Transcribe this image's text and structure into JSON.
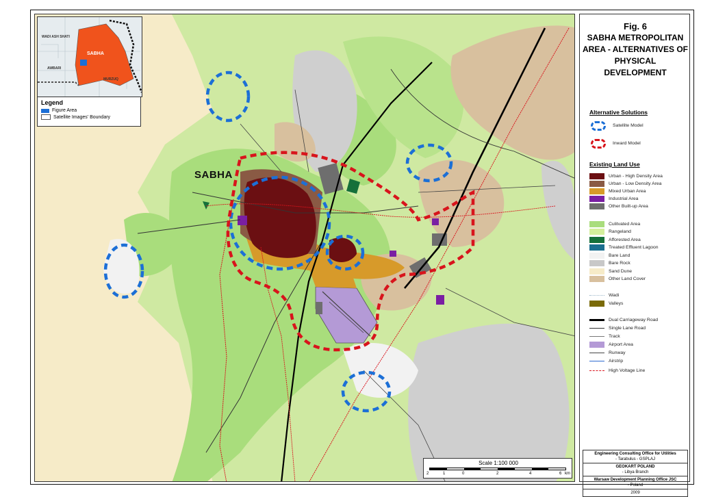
{
  "figure": {
    "number": "Fig. 6",
    "title_lines": [
      "SABHA METROPOLITAN",
      "AREA - ALTERNATIVES OF",
      "PHYSICAL DEVELOPMENT"
    ]
  },
  "map": {
    "city_label": "SABHA",
    "scale_text": "Scale 1:100 000",
    "scale_ticks": [
      "2",
      "1",
      "0",
      "2",
      "4",
      "6",
      "km"
    ]
  },
  "inset": {
    "labels": [
      "WADI ASH SHATI",
      "SABHA",
      "AWBARI",
      "MURZUQ"
    ],
    "legend_title": "Legend",
    "legend_items": [
      {
        "label": "Figure Area",
        "color": "#1c6fd6"
      },
      {
        "label": "Satellite Images' Boundary",
        "color": "#ffffff"
      }
    ]
  },
  "alternatives": {
    "title": "Alternative Solutions",
    "items": [
      {
        "label": "Satellite Model",
        "color": "#1c6fd6"
      },
      {
        "label": "Inward Model",
        "color": "#d8141c"
      }
    ]
  },
  "land_use": {
    "title": "Existing Land Use",
    "items": [
      {
        "label": "Urban - High Density Area",
        "color": "#6b0f12"
      },
      {
        "label": "Urban - Low Density Area",
        "color": "#8a5a44"
      },
      {
        "label": "Mixed Urban Area",
        "color": "#d79a2a"
      },
      {
        "label": "Industrial Area",
        "color": "#7a1fa3"
      },
      {
        "label": "Other Built-up Area",
        "color": "#6e6e6e"
      },
      {
        "label": "Culitvated Area",
        "color": "#a9dd7c"
      },
      {
        "label": "Rangeland",
        "color": "#d4ef9c"
      },
      {
        "label": "Afforested Area",
        "color": "#15703a"
      },
      {
        "label": "Treated Effluent Lagoon",
        "color": "#1b6f8f"
      },
      {
        "label": "Bare Land",
        "color": "#f2f2f2"
      },
      {
        "label": "Bare Rock",
        "color": "#c8c8c8"
      },
      {
        "label": "Sand Dune",
        "color": "#f6ebc8"
      },
      {
        "label": "Other Land Cover",
        "color": "#d8c09e"
      },
      {
        "label": "Wadi",
        "color": "#9bb7c9"
      },
      {
        "label": "Valleys",
        "color": "#7a6a08"
      },
      {
        "label": "Dual Carriageway Road",
        "color": "#000000"
      },
      {
        "label": "Single Lane Road",
        "color": "#333333"
      },
      {
        "label": "Track",
        "color": "#777777"
      },
      {
        "label": "Airport Area",
        "color": "#b49ad6"
      },
      {
        "label": "Runway",
        "color": "#444444"
      },
      {
        "label": "Airstrip",
        "color": "#2d6bd1"
      },
      {
        "label": "High Voltage Line",
        "color": "#d8141c"
      }
    ]
  },
  "credits": [
    {
      "bold": "Engineering Consulting Office for Utilities",
      "sub": "- Tarabulus - GSPLAJ"
    },
    {
      "bold": "GEOKART POLAND",
      "sub": "- Libya Branch"
    },
    {
      "bold": "Warsaw Development Planning Office JSC",
      "sub": "- Poland"
    },
    {
      "bold": "",
      "sub": "2009"
    }
  ]
}
